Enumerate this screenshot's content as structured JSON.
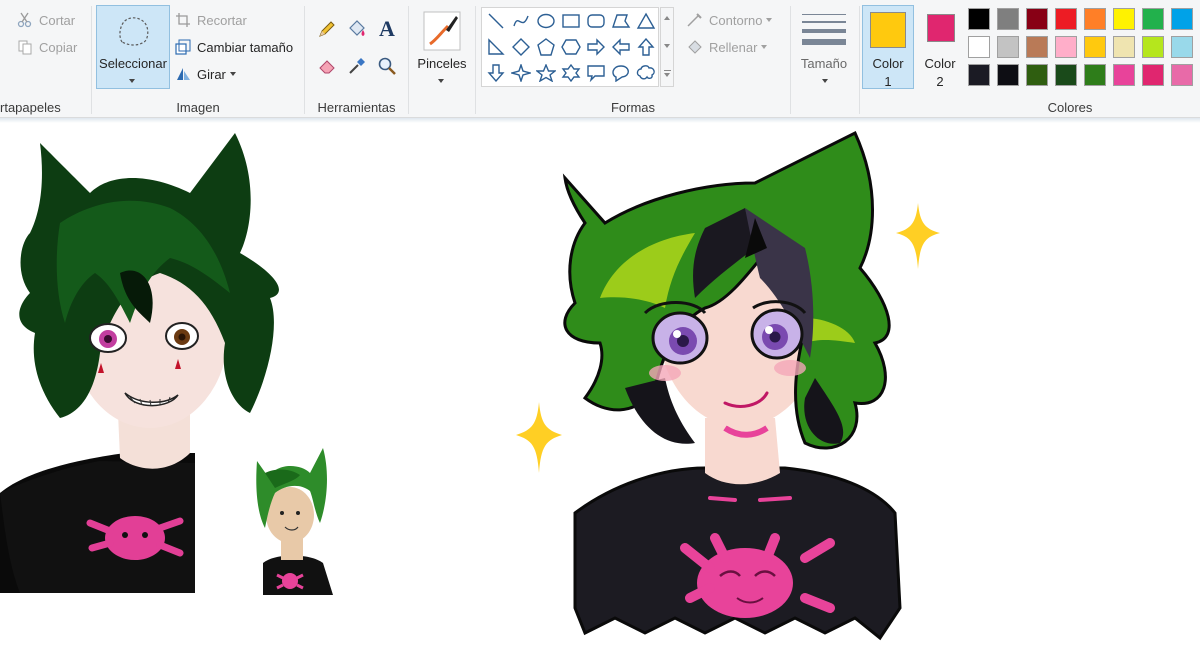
{
  "ribbon": {
    "clipboard": {
      "label": "rtapapeles",
      "cut": "Cortar",
      "copy": "Copiar"
    },
    "image": {
      "label": "Imagen",
      "select": "Seleccionar",
      "crop": "Recortar",
      "resize": "Cambiar tamaño",
      "rotate": "Girar"
    },
    "tools": {
      "label": "Herramientas",
      "items": [
        "pencil-icon",
        "fill-icon",
        "text-icon",
        "eraser-icon",
        "color-picker-icon",
        "magnifier-icon"
      ]
    },
    "brushes": {
      "label": "Pinceles"
    },
    "shapes": {
      "label": "Formas",
      "outline": "Contorno",
      "fill": "Rellenar"
    },
    "size": {
      "label": "Tamaño"
    },
    "colors": {
      "label": "Colores",
      "color1": {
        "label": "Color",
        "number": "1",
        "value": "#ffc90e"
      },
      "color2": {
        "label": "Color",
        "number": "2",
        "value": "#e0266f"
      },
      "palette": [
        [
          "#000000",
          "#7f7f7f",
          "#880015",
          "#ed1c24",
          "#ff7f27",
          "#fff200",
          "#22b14c",
          "#00a2e8"
        ],
        [
          "#ffffff",
          "#c3c3c3",
          "#b97a57",
          "#ffaec9",
          "#ffc90e",
          "#efe4b0",
          "#b5e61d",
          "#99d9ea"
        ],
        [
          "#1b1b24",
          "#0e0e14",
          "#2f5e10",
          "#1a4a1a",
          "#2e7d1a",
          "#e8439a",
          "#e0266f",
          "#e86aa8"
        ]
      ]
    }
  },
  "canvas": {
    "drawings": [
      "character-drawing-left",
      "character-drawing-small",
      "character-drawing-right"
    ]
  }
}
